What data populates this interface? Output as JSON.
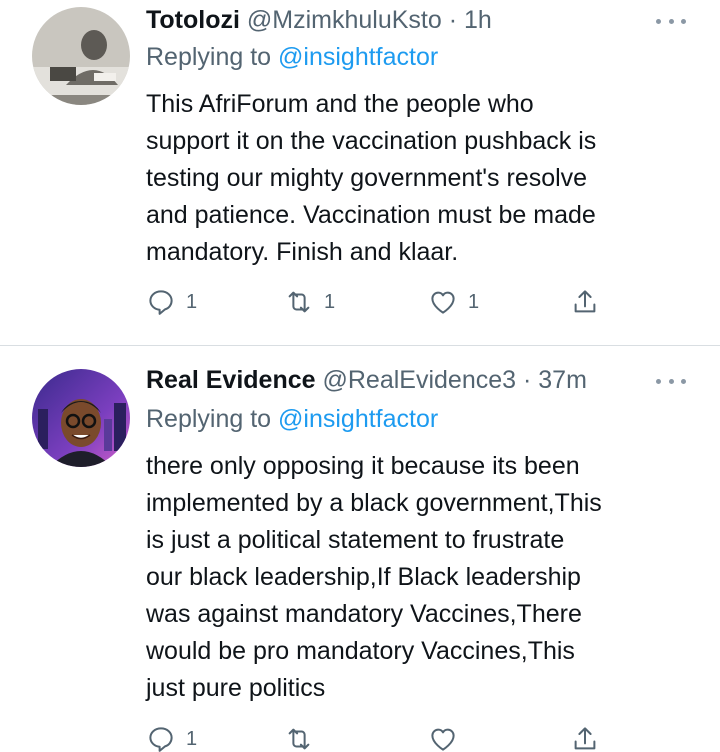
{
  "tweets": [
    {
      "name": "Totolozi",
      "handle": "@MzimkhuluKsto",
      "separator": "·",
      "time": "1h",
      "replying_prefix": "Replying to",
      "replying_to": "@insightfactor",
      "lines": [
        "This AfriForum and the people who",
        "support it on the vaccination pushback is",
        "testing our mighty government's resolve",
        "and patience. Vaccination must be made",
        "mandatory. Finish and klaar."
      ],
      "reply_count": "1",
      "retweet_count": "1",
      "like_count": "1"
    },
    {
      "name": "Real Evidence",
      "handle": "@RealEvidence3",
      "separator": "·",
      "time": "37m",
      "replying_prefix": "Replying to",
      "replying_to": "@insightfactor",
      "lines": [
        "there only opposing it because its been",
        "implemented by a black government,This",
        "is just a political statement to frustrate",
        "our black leadership,If Black leadership",
        "was against mandatory Vaccines,There",
        "would be pro mandatory Vaccines,This",
        "just pure politics"
      ],
      "reply_count": "1",
      "retweet_count": "",
      "like_count": ""
    }
  ],
  "icons": {
    "reply": "reply-icon",
    "retweet": "retweet-icon",
    "like": "heart-icon",
    "share": "share-icon",
    "more": "more-icon"
  },
  "colors": {
    "text": "#0f1419",
    "secondary": "#536471",
    "link": "#1d9bf0",
    "icon": "#536471",
    "divider": "#d9dee2"
  }
}
